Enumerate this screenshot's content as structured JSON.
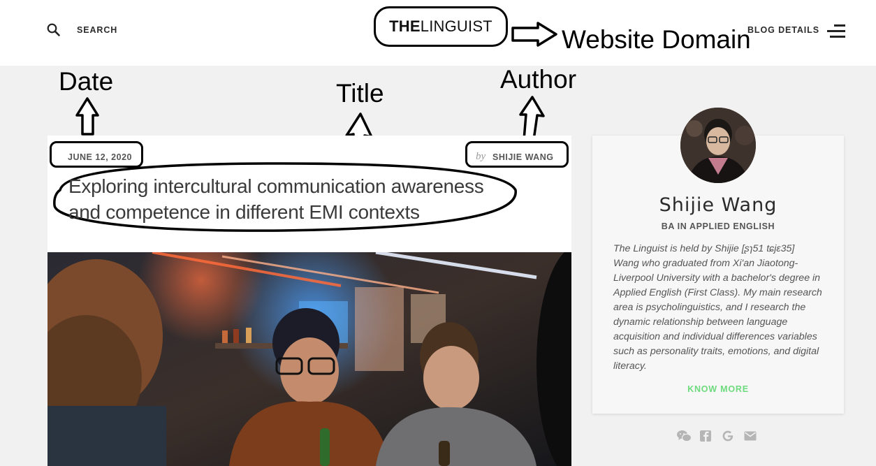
{
  "header": {
    "search_label": "SEARCH",
    "logo_bold": "THE",
    "logo_rest": "LINGUIST",
    "blog_details_label": "BLOG DETAILS"
  },
  "annotations": {
    "website_domain": "Website Domain",
    "date": "Date",
    "title": "Title",
    "author": "Author"
  },
  "article": {
    "date": "JUNE 12, 2020",
    "by": "by",
    "author": "SHIJIE WANG",
    "title": "Exploring intercultural communication awareness and competence in different EMI contexts"
  },
  "sidebar": {
    "name": "Shijie Wang",
    "subtitle": "BA IN APPLIED ENGLISH",
    "bio": "The Linguist is held by Shijie [ʂɿ51 tɕjɛ35] Wang who graduated from Xi'an Jiaotong-Liverpool University with a bachelor's degree in Applied English (First Class). My main research area is psycholinguistics, and I research the dynamic relationship between language acquisition and individual differences variables such as personality traits, emotions, and digital literacy.",
    "know_more": "KNOW MORE",
    "social_icons": [
      "wechat-icon",
      "facebook-icon",
      "google-icon",
      "email-icon"
    ]
  },
  "colors": {
    "accent": "#6ddb7d",
    "background": "#f1f1f1",
    "header": "#ffffff"
  }
}
